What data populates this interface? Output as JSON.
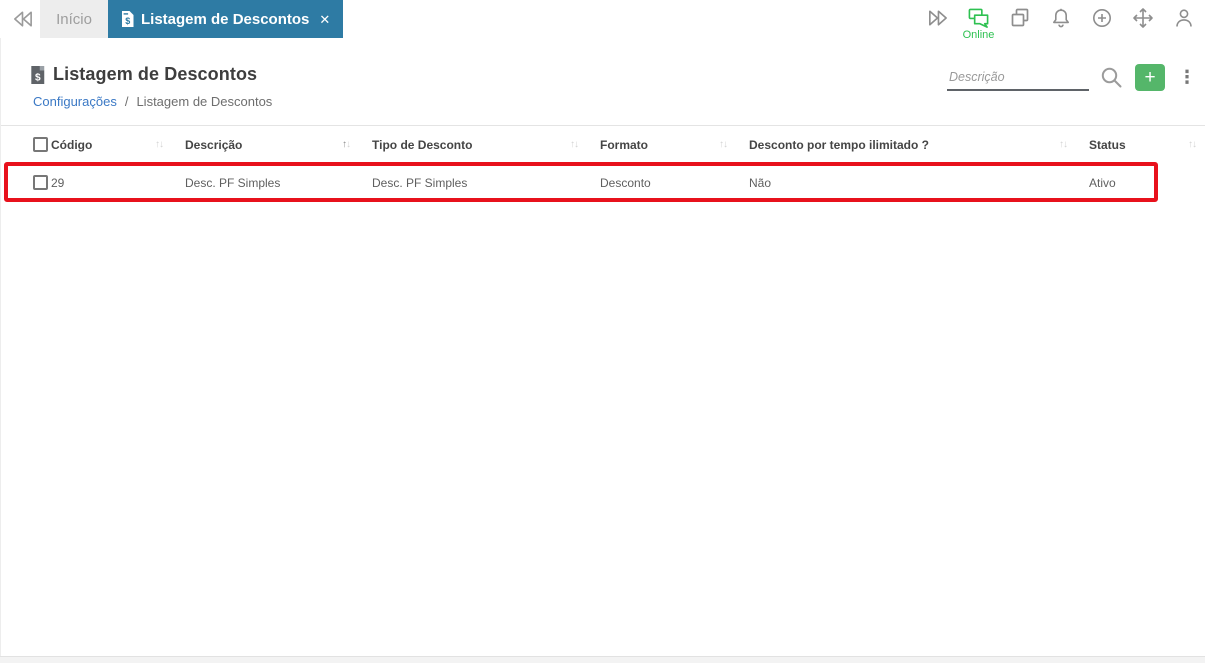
{
  "tab_bar": {
    "tabs": [
      {
        "label": "Início",
        "active": false
      },
      {
        "label": "Listagem de Descontos",
        "active": true
      }
    ],
    "status_label": "Online"
  },
  "page_header": {
    "title": "Listagem de Descontos",
    "breadcrumb": [
      {
        "label": "Configurações"
      },
      {
        "label": "Listagem de Descontos"
      }
    ],
    "breadcrumb_separator": "/",
    "search": {
      "placeholder": "Descrição",
      "value": ""
    },
    "add_button_label": "+"
  },
  "table": {
    "columns": [
      {
        "label": "Código",
        "sortable": true
      },
      {
        "label": "Descrição",
        "sortable": true,
        "sorted": "asc"
      },
      {
        "label": "Tipo de Desconto",
        "sortable": true
      },
      {
        "label": "Formato",
        "sortable": true
      },
      {
        "label": "Desconto por tempo ilimitado ?",
        "sortable": true
      },
      {
        "label": "Status",
        "sortable": true
      }
    ],
    "rows": [
      {
        "codigo": "29",
        "descricao": "Desc. PF Simples",
        "tipo_de_desconto": "Desc. PF Simples",
        "formato": "Desconto",
        "desconto_por_tempo_ilimitado": "Não",
        "status": "Ativo",
        "highlighted": true
      }
    ]
  },
  "ui": {
    "close_icon": "✕",
    "kebab_icon": "⋮",
    "sort_up_icon": "↑",
    "sort_down_icon": "↓",
    "dollar_glyph": "$"
  },
  "colors": {
    "active_tab_blue": "#2e7ba4",
    "online_green": "#2ec151",
    "add_button_green": "#55b66a",
    "link_blue": "#3b79c5",
    "highlight_red": "#e8111c"
  }
}
